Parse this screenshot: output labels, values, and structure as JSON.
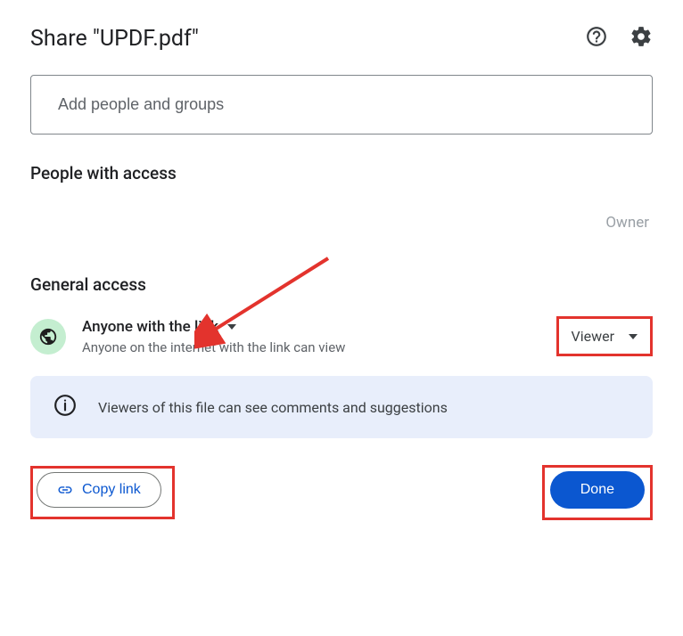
{
  "header": {
    "title": "Share \"UPDF.pdf\""
  },
  "input": {
    "placeholder": "Add people and groups"
  },
  "sections": {
    "people_heading": "People with access",
    "general_heading": "General access"
  },
  "people": {
    "owner_label": "Owner"
  },
  "access": {
    "scope_title": "Anyone with the link",
    "scope_subtitle": "Anyone on the internet with the link can view",
    "role": "Viewer"
  },
  "info": {
    "message": "Viewers of this file can see comments and suggestions"
  },
  "footer": {
    "copy_link": "Copy link",
    "done": "Done"
  },
  "annotations": {
    "highlights": [
      "role-dropdown",
      "copy-link-button",
      "done-button"
    ],
    "arrow_target": "general-access-heading"
  }
}
